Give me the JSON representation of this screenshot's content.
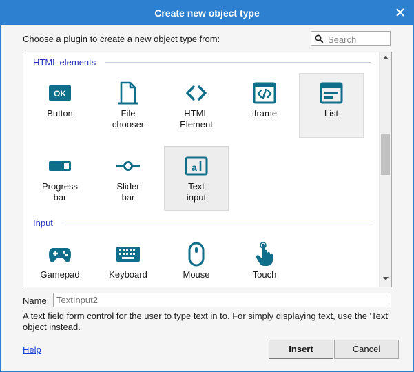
{
  "dialog": {
    "title": "Create new object type",
    "prompt": "Choose a plugin to create a new object type from:",
    "search_placeholder": "Search",
    "sections": [
      {
        "title": "HTML elements",
        "items": [
          {
            "label": "Button",
            "icon": "ok-button-icon",
            "selected": false
          },
          {
            "label": "File\nchooser",
            "icon": "file-icon",
            "selected": false
          },
          {
            "label": "HTML\nElement",
            "icon": "code-brackets-icon",
            "selected": false
          },
          {
            "label": "iframe",
            "icon": "code-window-icon",
            "selected": false
          },
          {
            "label": "List",
            "icon": "list-window-icon",
            "selected": false
          },
          {
            "label": "Progress\nbar",
            "icon": "progress-bar-icon",
            "selected": false
          },
          {
            "label": "Slider\nbar",
            "icon": "slider-icon",
            "selected": false
          },
          {
            "label": "Text\ninput",
            "icon": "text-input-icon",
            "selected": true
          }
        ]
      },
      {
        "title": "Input",
        "items": [
          {
            "label": "Gamepad",
            "icon": "gamepad-icon",
            "selected": false
          },
          {
            "label": "Keyboard",
            "icon": "keyboard-icon",
            "selected": false
          },
          {
            "label": "Mouse",
            "icon": "mouse-icon",
            "selected": false
          },
          {
            "label": "Touch",
            "icon": "touch-hand-icon",
            "selected": false
          }
        ]
      }
    ],
    "name_label": "Name",
    "name_placeholder": "TextInput2",
    "description": "A text field form control for the user to type text in to. For simply displaying text, use the 'Text' object instead.",
    "help_label": "Help",
    "insert_label": "Insert",
    "cancel_label": "Cancel"
  },
  "colors": {
    "titlebar": "#2d7fd0",
    "icon": "#0f6f8a",
    "section_title": "#2633b8",
    "link": "#1a3fd8"
  }
}
